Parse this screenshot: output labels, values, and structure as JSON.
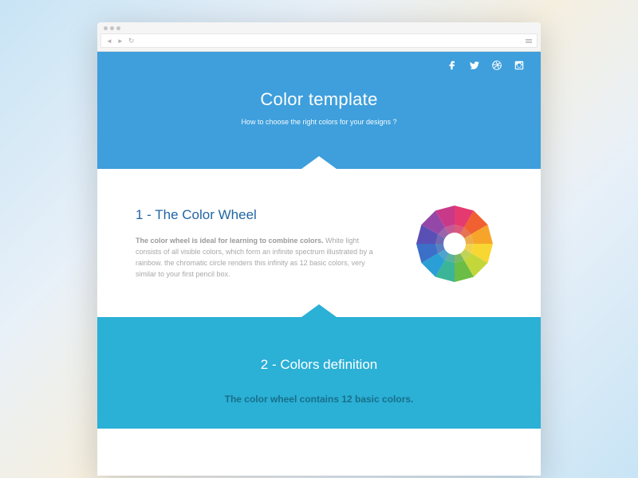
{
  "hero": {
    "title": "Color template",
    "subtitle": "How to choose the right colors for your designs ?"
  },
  "section1": {
    "heading": "1 - The Color Wheel",
    "lead": "The color wheel is ideal for learning to combine colors.",
    "body": " White light consists of all visible colors, which form an infinite spectrum illustrated by a rainbow. the chromatic circle renders this infinity as 12 basic colors, very similar to your first pencil box."
  },
  "section2": {
    "heading": "2 - Colors definition",
    "sub": "The color wheel contains 12 basic colors."
  },
  "colors": {
    "hero_bg": "#3e9fdc",
    "section2_bg": "#2bb0d6",
    "heading_blue": "#2266a5"
  }
}
